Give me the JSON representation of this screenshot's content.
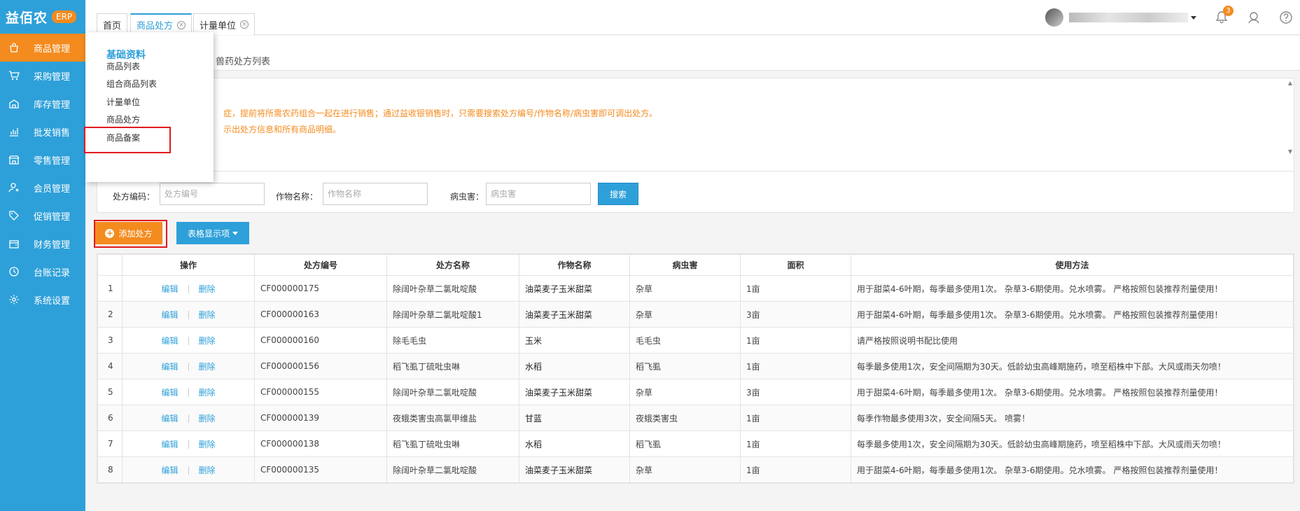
{
  "brand": {
    "name": "益佰农",
    "badge": "ERP"
  },
  "sidebar": {
    "items": [
      {
        "label": "商品管理",
        "icon": "bag-icon",
        "active": true
      },
      {
        "label": "采购管理",
        "icon": "cart-icon"
      },
      {
        "label": "库存管理",
        "icon": "warehouse-icon"
      },
      {
        "label": "批发销售",
        "icon": "chart-icon"
      },
      {
        "label": "零售管理",
        "icon": "store-icon"
      },
      {
        "label": "会员管理",
        "icon": "user-icon"
      },
      {
        "label": "促销管理",
        "icon": "tag-icon"
      },
      {
        "label": "财务管理",
        "icon": "wallet-icon"
      },
      {
        "label": "台账记录",
        "icon": "clock-icon"
      },
      {
        "label": "系统设置",
        "icon": "gear-icon"
      }
    ]
  },
  "tabs": [
    {
      "label": "首页"
    },
    {
      "label": "商品处方",
      "active": true
    },
    {
      "label": "计量单位"
    }
  ],
  "topbar": {
    "notification_count": "3"
  },
  "submenu": {
    "title": "基础资料",
    "items": [
      "商品列表",
      "组合商品列表",
      "计量单位",
      "商品处方",
      "商品备案"
    ]
  },
  "page": {
    "subtitle": "兽药处方列表",
    "notice_line1": "症，提前将所需农药组合一起在进行销售；通过益收银销售时，只需要搜索处方编号/作物名称/病虫害即可调出处方。",
    "notice_line2": "示出处方信息和所有商品明细。"
  },
  "search": {
    "code_label": "处方编码：",
    "code_placeholder": "处方编号",
    "crop_label": "作物名称：",
    "crop_placeholder": "作物名称",
    "pest_label": "病虫害：",
    "pest_placeholder": "病虫害",
    "button": "搜索"
  },
  "toolbar": {
    "add_label": "添加处方",
    "columns_label": "表格显示项"
  },
  "table": {
    "headers": [
      "",
      "操作",
      "处方编号",
      "处方名称",
      "作物名称",
      "病虫害",
      "面积",
      "使用方法"
    ],
    "edit_label": "编辑",
    "delete_label": "删除",
    "rows": [
      {
        "idx": "1",
        "code": "CF000000175",
        "name": "除阔叶杂草二氯吡啶酸",
        "crop": "油菜麦子玉米甜菜",
        "pest": "杂草",
        "area": "1亩",
        "usage": "用于甜菜4-6叶期，每季最多使用1次。 杂草3-6期使用。兑水喷雾。 严格按照包装推荐剂量使用！"
      },
      {
        "idx": "2",
        "code": "CF000000163",
        "name": "除阔叶杂草二氯吡啶酸1",
        "crop": "油菜麦子玉米甜菜",
        "pest": "杂草",
        "area": "3亩",
        "usage": "用于甜菜4-6叶期，每季最多使用1次。 杂草3-6期使用。兑水喷雾。 严格按照包装推荐剂量使用！"
      },
      {
        "idx": "3",
        "code": "CF000000160",
        "name": "除毛毛虫",
        "crop": "玉米",
        "pest": "毛毛虫",
        "area": "1亩",
        "usage": "请严格按照说明书配比使用"
      },
      {
        "idx": "4",
        "code": "CF000000156",
        "name": "稻飞虱丁硫吡虫啉",
        "crop": "水稻",
        "pest": "稻飞虱",
        "area": "1亩",
        "usage": "每季最多使用1次，安全间隔期为30天。低龄幼虫高峰期施药，喷至稻株中下部。大风或雨天勿喷！"
      },
      {
        "idx": "5",
        "code": "CF000000155",
        "name": "除阔叶杂草二氯吡啶酸",
        "crop": "油菜麦子玉米甜菜",
        "pest": "杂草",
        "area": "3亩",
        "usage": "用于甜菜4-6叶期，每季最多使用1次。 杂草3-6期使用。兑水喷雾。 严格按照包装推荐剂量使用！"
      },
      {
        "idx": "6",
        "code": "CF000000139",
        "name": "夜蛾类害虫高氯甲维盐",
        "crop": "甘蓝",
        "pest": "夜蛾类害虫",
        "area": "1亩",
        "usage": "每季作物最多使用3次，安全间隔5天。 喷雾！"
      },
      {
        "idx": "7",
        "code": "CF000000138",
        "name": "稻飞虱丁硫吡虫啉",
        "crop": "水稻",
        "pest": "稻飞虱",
        "area": "1亩",
        "usage": "每季最多使用1次，安全间隔期为30天。低龄幼虫高峰期施药，喷至稻株中下部。大风或雨天勿喷！"
      },
      {
        "idx": "8",
        "code": "CF000000135",
        "name": "除阔叶杂草二氯吡啶酸",
        "crop": "油菜麦子玉米甜菜",
        "pest": "杂草",
        "area": "1亩",
        "usage": "用于甜菜4-6叶期，每季最多使用1次。 杂草3-6期使用。兑水喷雾。 严格按照包装推荐剂量使用！"
      }
    ]
  },
  "colors": {
    "primary": "#2ea0d9",
    "accent": "#f48b1f",
    "highlight": "#e0191c"
  }
}
